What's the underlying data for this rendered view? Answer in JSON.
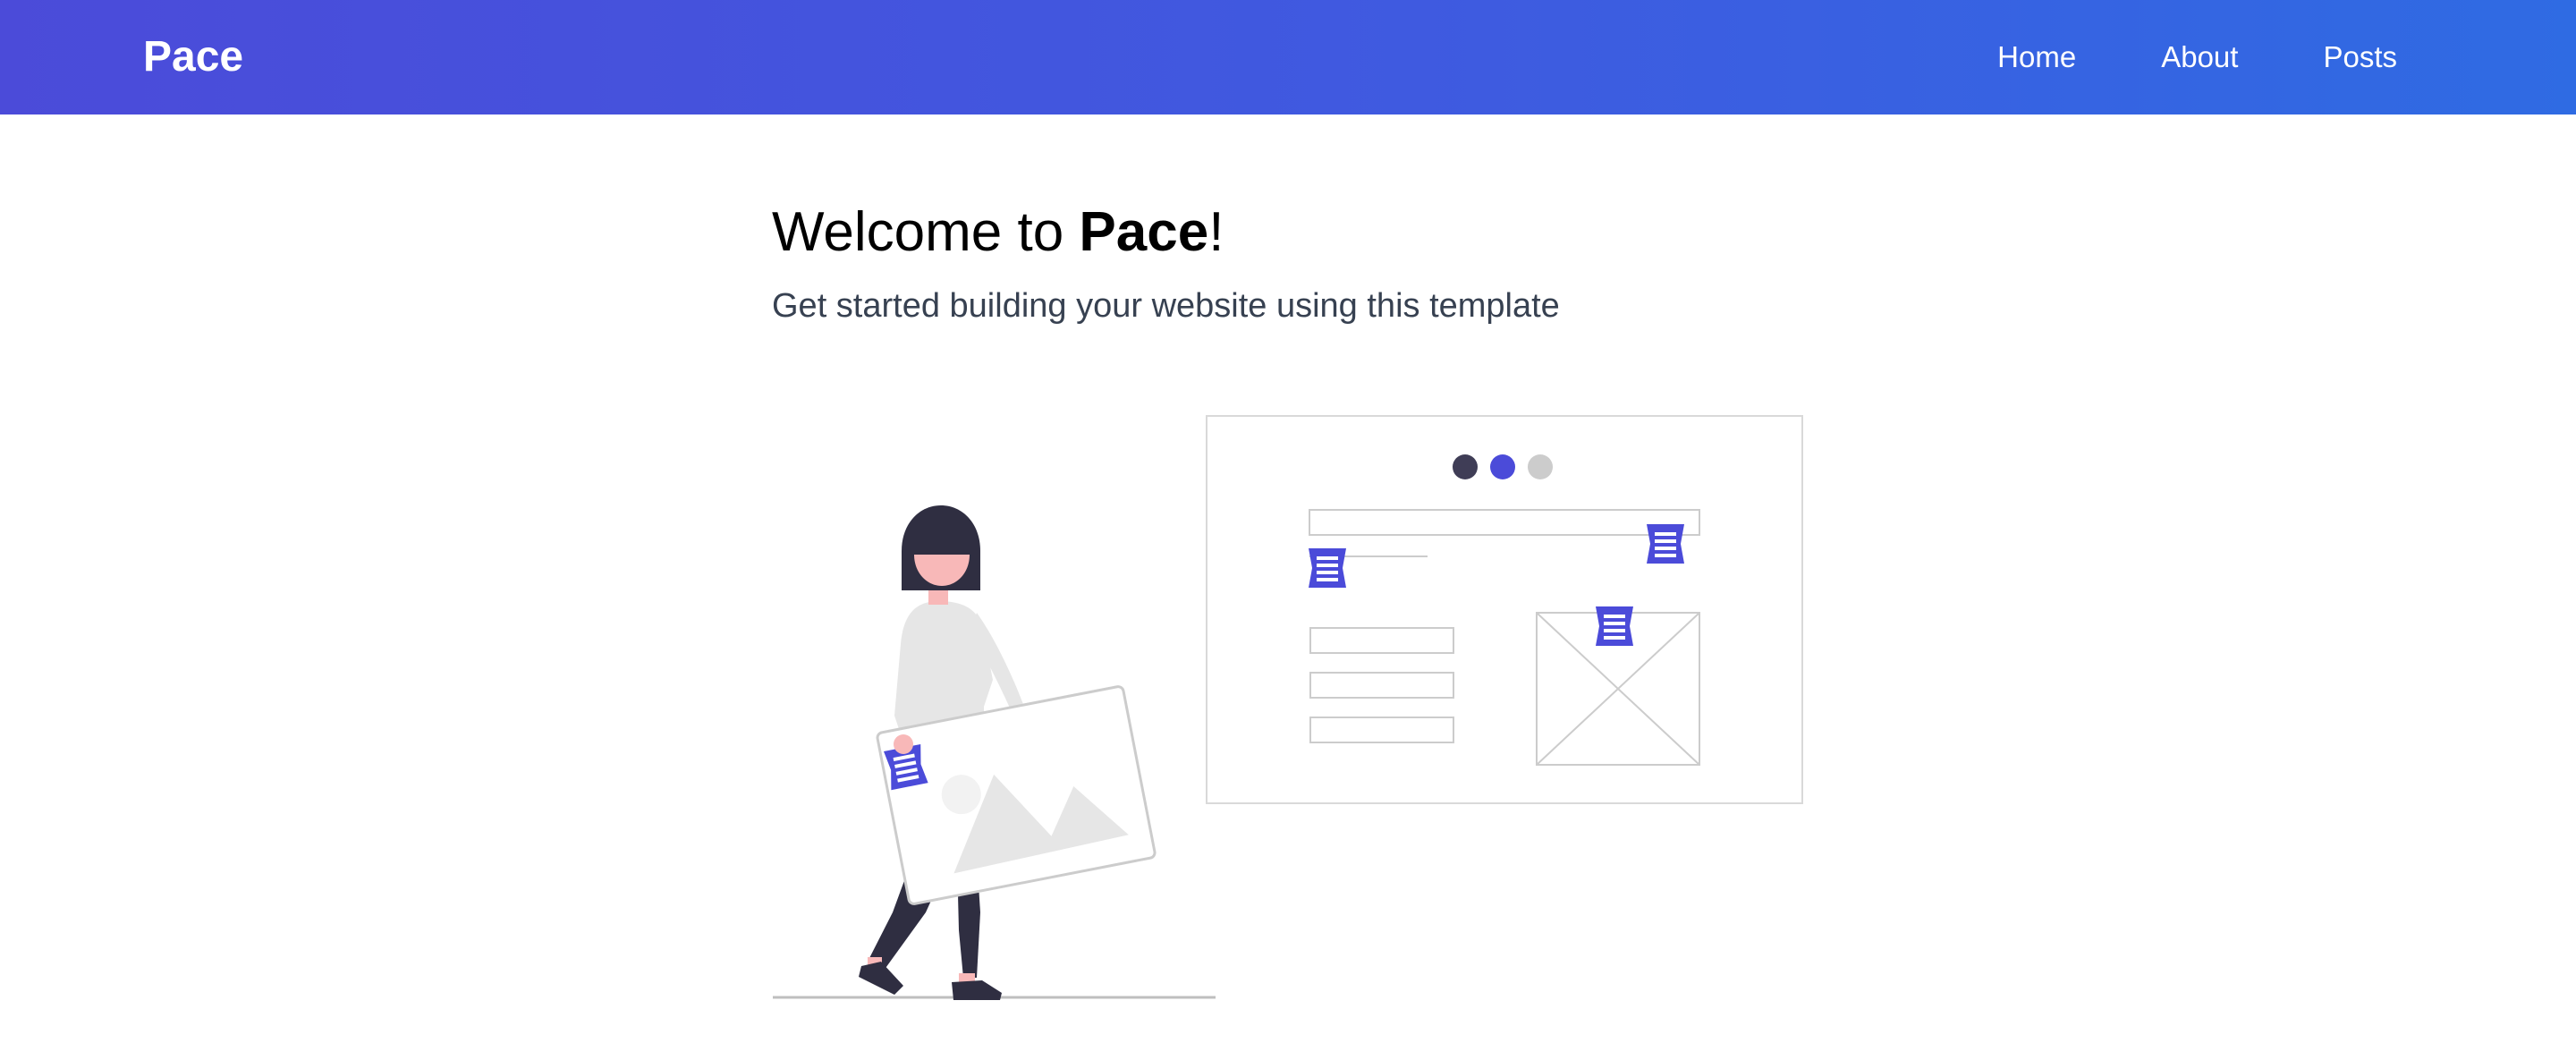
{
  "brand": "Pace",
  "nav": {
    "home": "Home",
    "about": "About",
    "posts": "Posts"
  },
  "hero": {
    "title_prefix": "Welcome to ",
    "title_brand": "Pace",
    "title_suffix": "!",
    "subtitle": "Get started building your website using this template"
  },
  "colors": {
    "nav_gradient_start": "#4b4bd9",
    "nav_gradient_end": "#2f6be3",
    "accent": "#4b4bd9",
    "dark": "#2f2e41",
    "skin": "#f8b8b8",
    "light_gray": "#e6e6e6"
  },
  "illustration": {
    "icon": "website-template-illustration"
  }
}
